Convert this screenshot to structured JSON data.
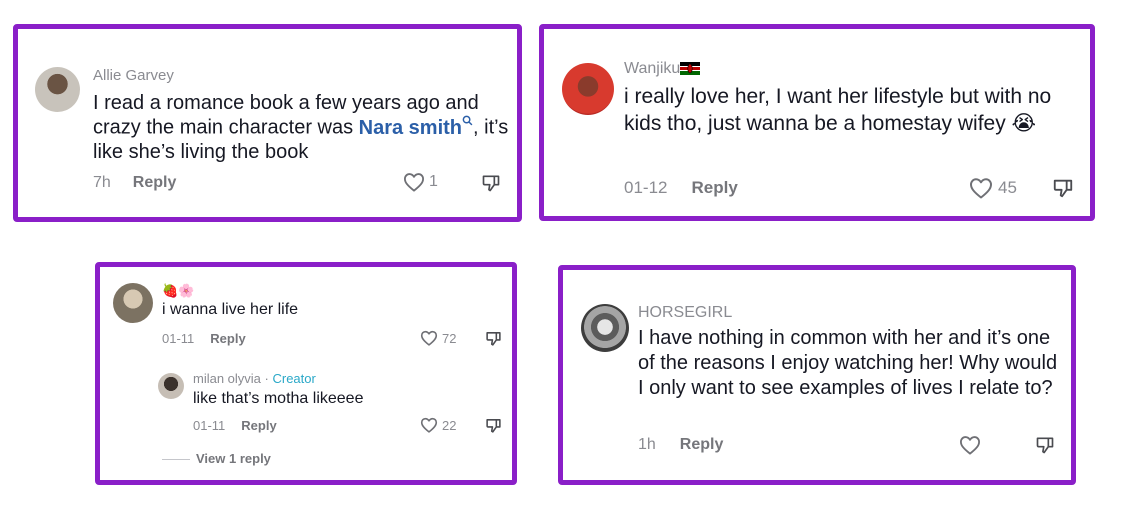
{
  "comments": [
    {
      "user": "Allie Garvey",
      "text_pre": "I read a romance book a few years ago and crazy the main character was ",
      "mention": "Nara smith",
      "text_post": ", it’s like she’s living the book",
      "time": "7h",
      "reply_label": "Reply",
      "likes": "1"
    },
    {
      "user": "Wanjiku",
      "text": "i really love her, I want her lifestyle but with no kids tho, just wanna be a homestay wifey 😭",
      "time": "01-12",
      "reply_label": "Reply",
      "likes": "45"
    },
    {
      "user": "🍓🌸",
      "text": "i wanna live her life",
      "time": "01-11",
      "reply_label": "Reply",
      "likes": "72",
      "replies": [
        {
          "user": "milan olyvia",
          "separator": " · ",
          "badge": "Creator",
          "text": "like that’s motha likeeee",
          "time": "01-11",
          "reply_label": "Reply",
          "likes": "22"
        }
      ],
      "view_replies_label": "View 1 reply"
    },
    {
      "user": "HORSEGIRL",
      "text": "I have nothing in common with her and it’s one of the reasons I enjoy watching her! Why would I only want to see examples of lives I relate to?",
      "time": "1h",
      "reply_label": "Reply",
      "likes": ""
    }
  ],
  "colors": {
    "frame": "#8a1fc8",
    "username": "#8a8b91",
    "mention": "#2b5fa8",
    "creator_badge": "#2aa8c8",
    "text": "#161823"
  },
  "icons": [
    "heart-icon",
    "dislike-icon",
    "search-icon",
    "kenya-flag-icon"
  ]
}
